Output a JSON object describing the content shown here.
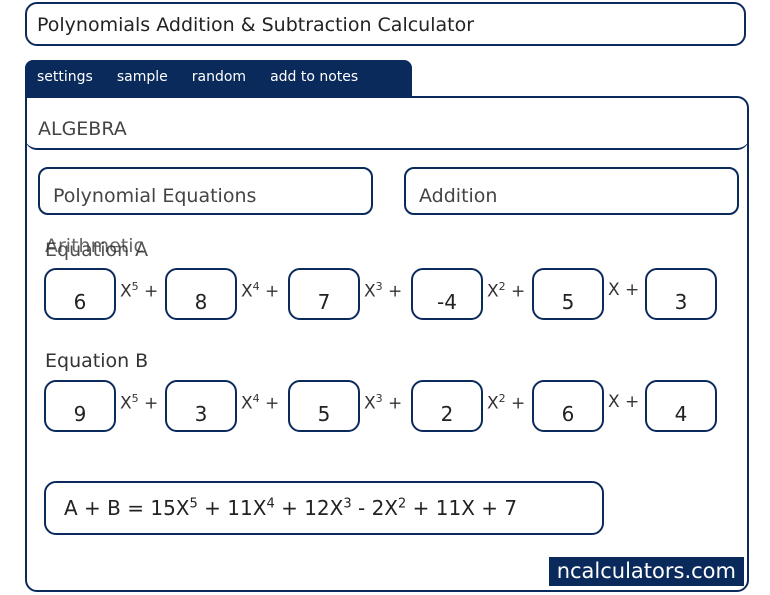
{
  "app": {
    "title": "Polynomials Addition & Subtraction Calculator"
  },
  "tabs": [
    "settings",
    "sample",
    "random",
    "add to notes"
  ],
  "category": "ALGEBRA",
  "selectors": {
    "topic": "Polynomial Equations",
    "operation": "Addition"
  },
  "overlay_label": "Arithmetic",
  "equation_a": {
    "label": "Equation A",
    "coefficients": [
      "6",
      "8",
      "7",
      "-4",
      "5",
      "3"
    ]
  },
  "equation_b": {
    "label": "Equation B",
    "coefficients": [
      "9",
      "3",
      "5",
      "2",
      "6",
      "4"
    ]
  },
  "terms": [
    {
      "base": "X",
      "exp": "5",
      "op": "+"
    },
    {
      "base": "X",
      "exp": "4",
      "op": "+"
    },
    {
      "base": "X",
      "exp": "3",
      "op": "+"
    },
    {
      "base": "X",
      "exp": "2",
      "op": "+"
    },
    {
      "base": "X",
      "exp": "",
      "op": "+"
    }
  ],
  "result": {
    "lhs": "A + B  =",
    "parts": [
      {
        "coef": "15X",
        "exp": "5",
        "op": " + "
      },
      {
        "coef": "11X",
        "exp": "4",
        "op": " + "
      },
      {
        "coef": "12X",
        "exp": "3",
        "op": " - "
      },
      {
        "coef": "2X",
        "exp": "2",
        "op": " + "
      },
      {
        "coef": "11X",
        "exp": "",
        "op": " + "
      },
      {
        "coef": "7",
        "exp": "",
        "op": ""
      }
    ]
  },
  "brand": "ncalculators.com"
}
